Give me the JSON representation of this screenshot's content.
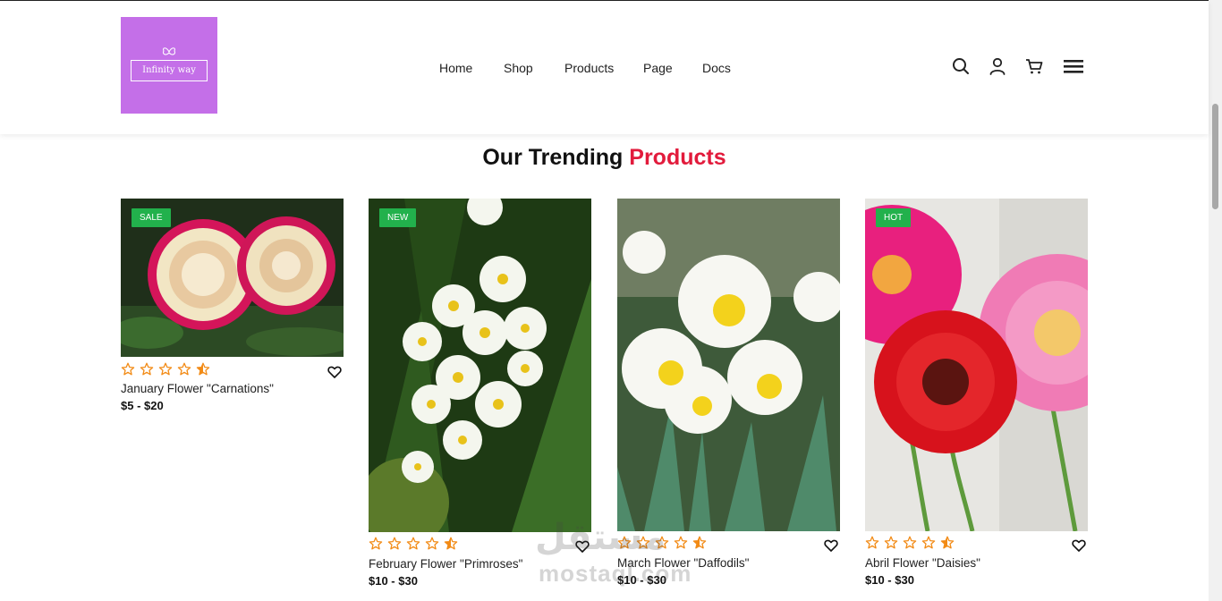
{
  "brand": {
    "name": "Infinity way",
    "logo_color": "#c46fe8"
  },
  "nav": [
    "Home",
    "Shop",
    "Products",
    "Page",
    "Docs"
  ],
  "header_icons": [
    "search-icon",
    "user-icon",
    "cart-icon",
    "menu-icon"
  ],
  "section": {
    "title_main": "Our Trending",
    "title_accent": "Products",
    "accent_color": "#e21b3c"
  },
  "products": [
    {
      "badge": "SALE",
      "name": "January Flower \"Carnations\"",
      "price": "$5 - $20",
      "rating": 4.5
    },
    {
      "badge": "NEW",
      "name": "February Flower \"Primroses\"",
      "price": "$10 - $30",
      "rating": 4.5
    },
    {
      "badge": "",
      "name": "March Flower \"Daffodils\"",
      "price": "$10 - $30",
      "rating": 4.5
    },
    {
      "badge": "HOT",
      "name": "Abril Flower \"Daisies\"",
      "price": "$10 - $30",
      "rating": 4.5
    }
  ],
  "colors": {
    "badge_green": "#22b14c",
    "star_orange": "#f28b16"
  },
  "watermark": {
    "arabic": "مستقل",
    "latin": "mostaql.com"
  }
}
